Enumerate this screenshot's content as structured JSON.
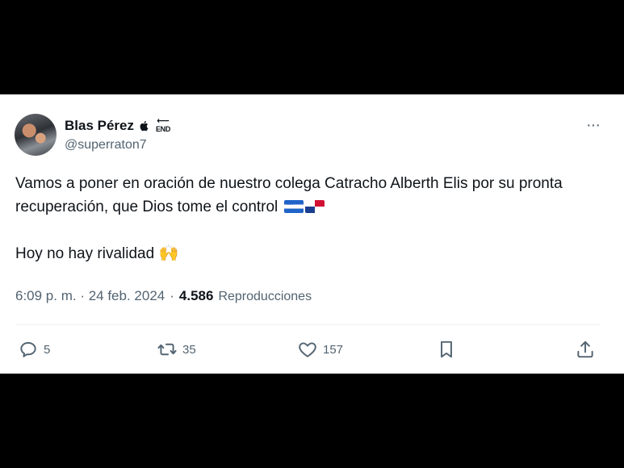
{
  "tweet": {
    "author_name": "Blas Pérez",
    "badge_text": "END",
    "handle": "@superraton7",
    "text_line1": "Vamos a poner en oración de nuestro colega Catracho Alberth Elis por su pronta recuperación, que Dios tome el control",
    "text_line2": "Hoy no hay rivalidad",
    "timestamp": "6:09 p. m. · 24 feb. 2024",
    "separator": "·",
    "views_count": "4.586",
    "views_label": "Reproducciones"
  },
  "actions": {
    "replies": "5",
    "retweets": "35",
    "likes": "157"
  },
  "icons": {
    "more": "more-icon",
    "reply": "reply-icon",
    "retweet": "retweet-icon",
    "like": "heart-icon",
    "bookmark": "bookmark-icon",
    "share": "share-icon"
  },
  "colors": {
    "text": "#0f1419",
    "secondary": "#536471",
    "background": "#ffffff",
    "frame": "#000000"
  }
}
